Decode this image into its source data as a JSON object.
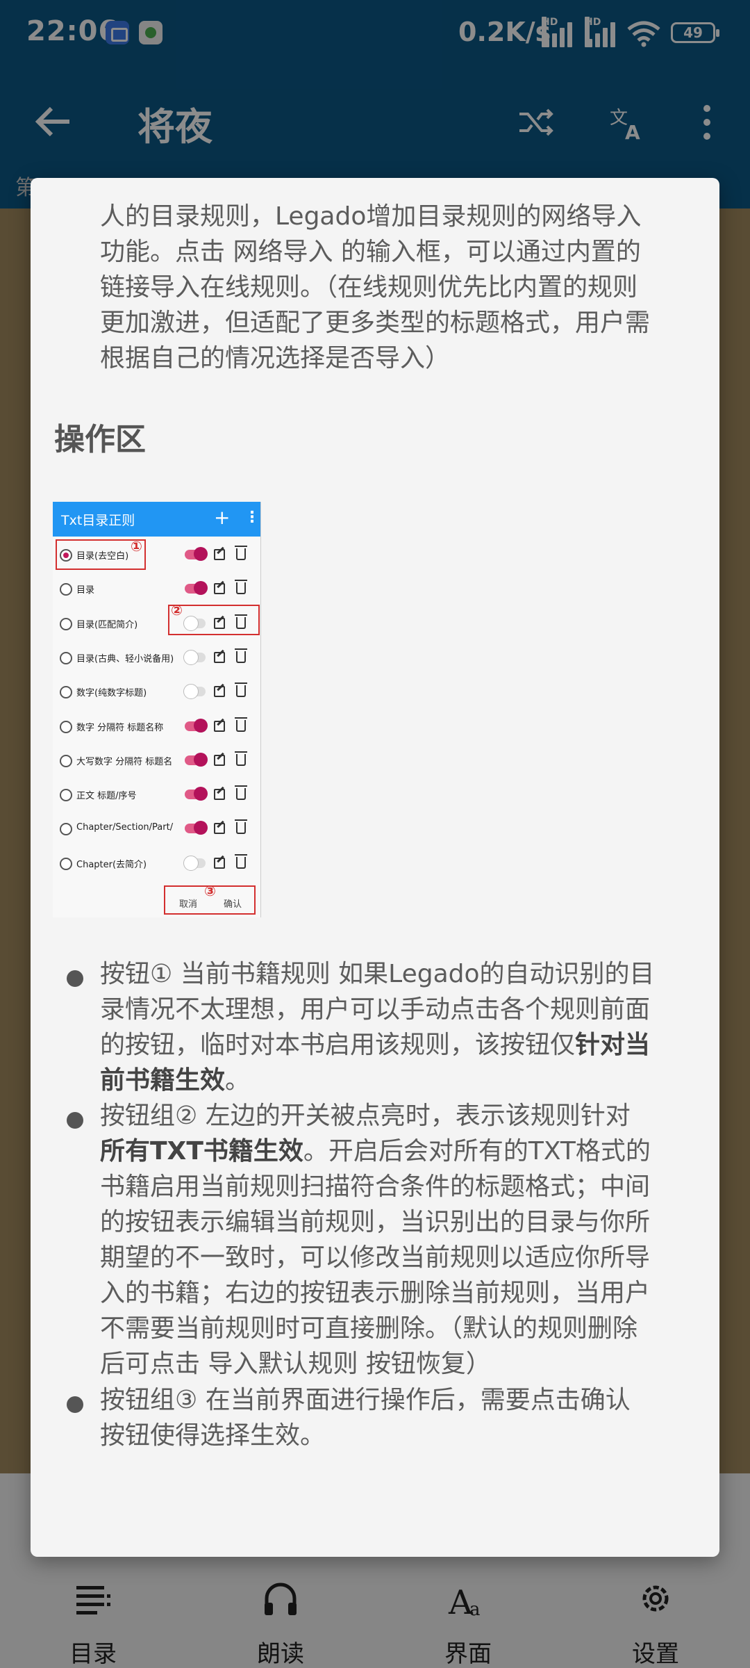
{
  "status_bar": {
    "time": "22:06",
    "network_speed": "0.2K/s",
    "signal_label": "HD",
    "battery": "49"
  },
  "app_bar": {
    "title": "将夜",
    "icons": [
      "back-arrow-icon",
      "swap-source-icon",
      "translate-icon",
      "more-vertical-icon"
    ]
  },
  "chapter_strip": {
    "text": "第"
  },
  "dialog": {
    "intro_lines": [
      "人的目录规则，Legado增加目录规则的网络导入",
      "功能。点击 网络导入 的输入框，可以通过内置的",
      "链接导入在线规则。（在线规则优先比内置的规则",
      "更加激进，但适配了更多类型的标题格式，用户需",
      "根据自己的情况选择是否导入）"
    ],
    "section_title": "操作区",
    "screenshot": {
      "title": "Txt目录正则",
      "add_symbol": "+",
      "more_symbol": "⋮",
      "rules": [
        {
          "label": "目录(去空白)",
          "selected": true,
          "enabled": true
        },
        {
          "label": "目录",
          "selected": false,
          "enabled": true
        },
        {
          "label": "目录(匹配简介)",
          "selected": false,
          "enabled": false
        },
        {
          "label": "目录(古典、轻小说备用)",
          "selected": false,
          "enabled": false
        },
        {
          "label": "数字(纯数字标题)",
          "selected": false,
          "enabled": false
        },
        {
          "label": "数字 分隔符 标题名称",
          "selected": false,
          "enabled": true
        },
        {
          "label": "大写数字 分隔符 标题名",
          "selected": false,
          "enabled": true
        },
        {
          "label": "正文 标题/序号",
          "selected": false,
          "enabled": true
        },
        {
          "label": "Chapter/Section/Part/",
          "selected": false,
          "enabled": true
        },
        {
          "label": "Chapter(去简介)",
          "selected": false,
          "enabled": false
        }
      ],
      "markers": [
        "①",
        "②",
        "③"
      ],
      "cancel_label": "取消",
      "confirm_label": "确认"
    },
    "bullets": [
      {
        "lines": [
          [
            {
              "t": "按钮① 当前书籍规则 如果Legado的自动识别的目"
            }
          ],
          [
            {
              "t": "录情况不太理想，用户可以手动点击各个规则前面"
            }
          ],
          [
            {
              "t": "的按钮，临时对本书启用该规则，该按钮仅"
            },
            {
              "t": "针对当",
              "b": true
            }
          ],
          [
            {
              "t": "前书籍生效",
              "b": true
            },
            {
              "t": "。"
            }
          ]
        ]
      },
      {
        "lines": [
          [
            {
              "t": "按钮组② 左边的开关被点亮时，表示该规则针对"
            }
          ],
          [
            {
              "t": "所有TXT书籍生效",
              "b": true
            },
            {
              "t": "。开启后会对所有的TXT格式的"
            }
          ],
          [
            {
              "t": "书籍启用当前规则扫描符合条件的标题格式；中间"
            }
          ],
          [
            {
              "t": "的按钮表示编辑当前规则，当识别出的目录与你所"
            }
          ],
          [
            {
              "t": "期望的不一致时，可以修改当前规则以适应你所导"
            }
          ],
          [
            {
              "t": "入的书籍；右边的按钮表示删除当前规则，当用户"
            }
          ],
          [
            {
              "t": "不需要当前规则时可直接删除。（默认的规则删除"
            }
          ],
          [
            {
              "t": "后可点击 导入默认规则 按钮恢复）"
            }
          ]
        ]
      },
      {
        "lines": [
          [
            {
              "t": "按钮组③ 在当前界面进行操作后，需要点击确认"
            }
          ],
          [
            {
              "t": "按钮使得选择生效。"
            }
          ]
        ]
      }
    ]
  },
  "bottom_nav": {
    "items": [
      {
        "label": "目录",
        "icon": "catalog-list-icon"
      },
      {
        "label": "朗读",
        "icon": "headphones-icon"
      },
      {
        "label": "界面",
        "icon": "font-style-icon"
      },
      {
        "label": "设置",
        "icon": "settings-gear-icon"
      }
    ]
  },
  "colors": {
    "app_bar": "#0b5886",
    "reading_background": "#a28a5f",
    "dialog_background": "#f4f4f4",
    "screenshot_header": "#2196f3",
    "highlight_box": "#d32f2f",
    "switch_on": "#b3125a"
  }
}
